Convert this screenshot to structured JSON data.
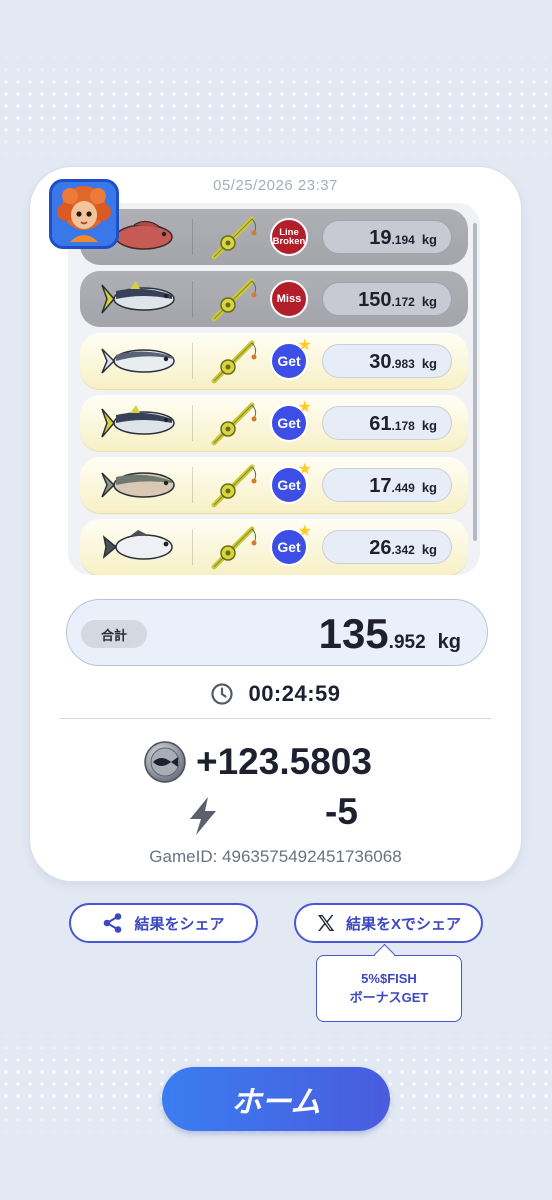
{
  "result": {
    "datetime": "05/25/2026 23:37",
    "catches": [
      {
        "status": "Line Broken",
        "status_lines": [
          "Line",
          "Broken"
        ],
        "weight_int": "19",
        "weight_dec": ".194",
        "unit": "kg",
        "fish": "red-snapper"
      },
      {
        "status": "Miss",
        "status_lines": [
          "Miss"
        ],
        "weight_int": "150",
        "weight_dec": ".172",
        "unit": "kg",
        "fish": "tuna"
      },
      {
        "status": "Get",
        "status_lines": [
          "Get"
        ],
        "weight_int": "30",
        "weight_dec": ".983",
        "unit": "kg",
        "fish": "yellowtail"
      },
      {
        "status": "Get",
        "status_lines": [
          "Get"
        ],
        "weight_int": "61",
        "weight_dec": ".178",
        "unit": "kg",
        "fish": "tuna"
      },
      {
        "status": "Get",
        "status_lines": [
          "Get"
        ],
        "weight_int": "17",
        "weight_dec": ".449",
        "unit": "kg",
        "fish": "salmon"
      },
      {
        "status": "Get",
        "status_lines": [
          "Get"
        ],
        "weight_int": "26",
        "weight_dec": ".342",
        "unit": "kg",
        "fish": "bass"
      }
    ],
    "total_label": "合計",
    "total_int": "135",
    "total_dec": ".952",
    "total_unit": "kg",
    "elapsed_time": "00:24:59",
    "reward": "+123.5803",
    "energy": "-5",
    "game_id": "GameID: 4963575492451736068"
  },
  "actions": {
    "share_label": "結果をシェア",
    "share_x_label": "結果をXでシェア",
    "bonus_line1": "5%$FISH",
    "bonus_line2": "ボーナスGET",
    "home_label": "ホーム"
  },
  "colors": {
    "background": "#e3e9f3",
    "accent": "#4a56d6",
    "miss_red": "#b31e2b",
    "get_blue": "#3d4ee6",
    "home_gradient": [
      "#3a7df0",
      "#4a5be0"
    ]
  },
  "icons": [
    "share-icon",
    "x-logo-icon",
    "clock-icon",
    "fish-token-icon",
    "lightning-icon",
    "star-icon",
    "fishing-rod-icon"
  ]
}
